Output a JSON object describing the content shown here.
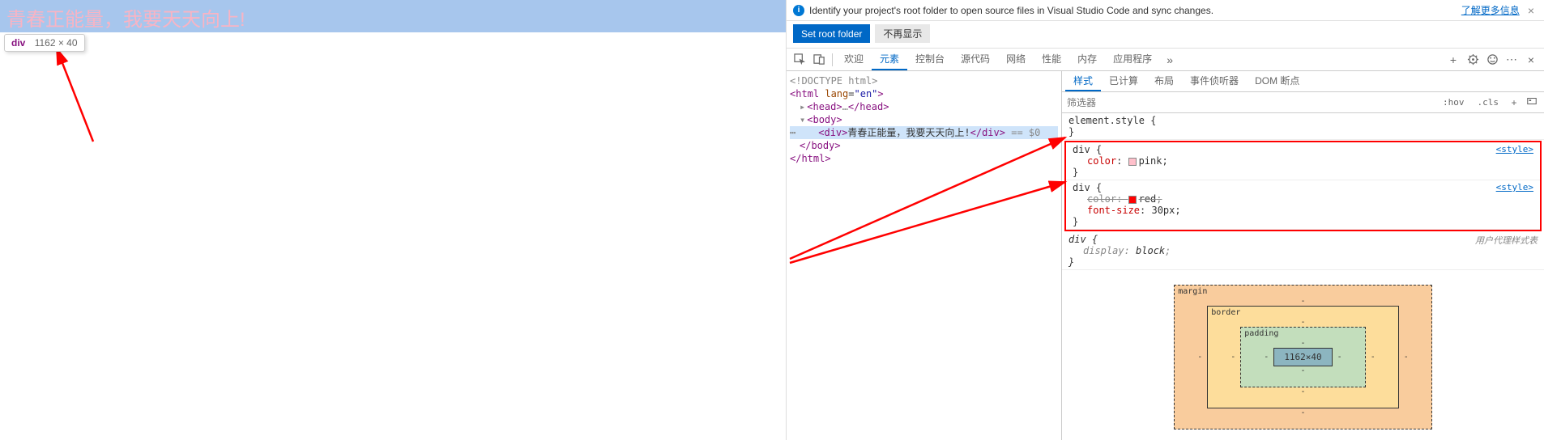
{
  "page": {
    "highlighted_text": "青春正能量，我要天天向上!",
    "tooltip_tag": "div",
    "tooltip_dim": "1162 × 40"
  },
  "info_bar": {
    "text": "Identify your project's root folder to open source files in Visual Studio Code and sync changes.",
    "link": "了解更多信息",
    "set_root": "Set root folder",
    "dont_show": "不再显示"
  },
  "tabs": {
    "welcome": "欢迎",
    "elements": "元素",
    "console": "控制台",
    "sources": "源代码",
    "network": "网络",
    "performance": "性能",
    "memory": "内存",
    "application": "应用程序"
  },
  "dom": {
    "doctype": "<!DOCTYPE html>",
    "html_open": "<html lang=\"en\">",
    "head": "<head>",
    "head_ellipsis": "…",
    "head_close": "</head>",
    "body_open": "<body>",
    "div_open": "<div>",
    "div_text": "青春正能量，我要天天向上!",
    "div_close": "</div>",
    "selected_marker": " == $0",
    "body_close": "</body>",
    "html_close": "</html>"
  },
  "sub_tabs": {
    "styles": "样式",
    "computed": "已计算",
    "layout": "布局",
    "event": "事件侦听器",
    "dom_bp": "DOM 断点"
  },
  "filter": {
    "placeholder": "筛选器",
    "hov": ":hov",
    "cls": ".cls"
  },
  "rules": {
    "element_style": "element.style",
    "div_sel": "div",
    "color": "color",
    "pink": "pink",
    "red": "red",
    "font_size": "font-size",
    "px30": "30px",
    "display": "display",
    "block": "block",
    "style_link": "<style>",
    "ua_label": "用户代理样式表"
  },
  "box_model": {
    "margin": "margin",
    "border": "border",
    "padding": "padding",
    "content": "1162×40",
    "dash": "-"
  }
}
